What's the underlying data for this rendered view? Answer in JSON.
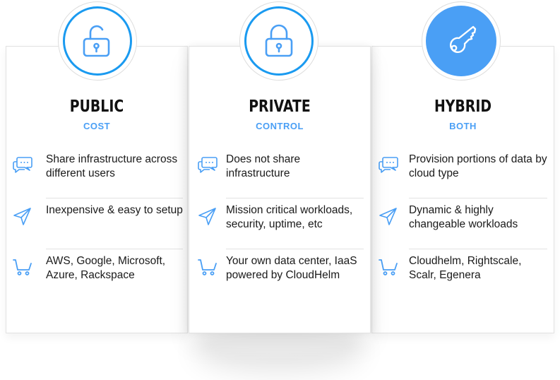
{
  "colors": {
    "accent": "#4a9ff5",
    "ring": "#1a9af0",
    "title": "#111111",
    "text": "#1a1a1a",
    "divider": "#e2e2e2"
  },
  "plans": [
    {
      "title": "PUBLIC",
      "subtitle": "COST",
      "badge_icon": "unlocked-padlock-icon",
      "badge_style": "outlined",
      "features": [
        {
          "icon": "chat-bubbles-icon",
          "text": "Share infrastructure across different users"
        },
        {
          "icon": "paper-plane-icon",
          "text": "Inexpensive & easy to setup"
        },
        {
          "icon": "shopping-cart-icon",
          "text": "AWS, Google, Microsoft, Azure, Rackspace"
        }
      ]
    },
    {
      "title": "PRIVATE",
      "subtitle": "CONTROL",
      "badge_icon": "locked-padlock-icon",
      "badge_style": "outlined",
      "features": [
        {
          "icon": "chat-bubbles-icon",
          "text": "Does not share infrastructure"
        },
        {
          "icon": "paper-plane-icon",
          "text": "Mission critical workloads, security, uptime, etc"
        },
        {
          "icon": "shopping-cart-icon",
          "text": "Your own data center, IaaS powered by CloudHelm"
        }
      ]
    },
    {
      "title": "HYBRID",
      "subtitle": "BOTH",
      "badge_icon": "key-icon",
      "badge_style": "filled",
      "features": [
        {
          "icon": "chat-bubbles-icon",
          "text": "Provision portions of data by cloud type"
        },
        {
          "icon": "paper-plane-icon",
          "text": "Dynamic & highly changeable workloads"
        },
        {
          "icon": "shopping-cart-icon",
          "text": "Cloudhelm, Rightscale, Scalr, Egenera"
        }
      ]
    }
  ]
}
